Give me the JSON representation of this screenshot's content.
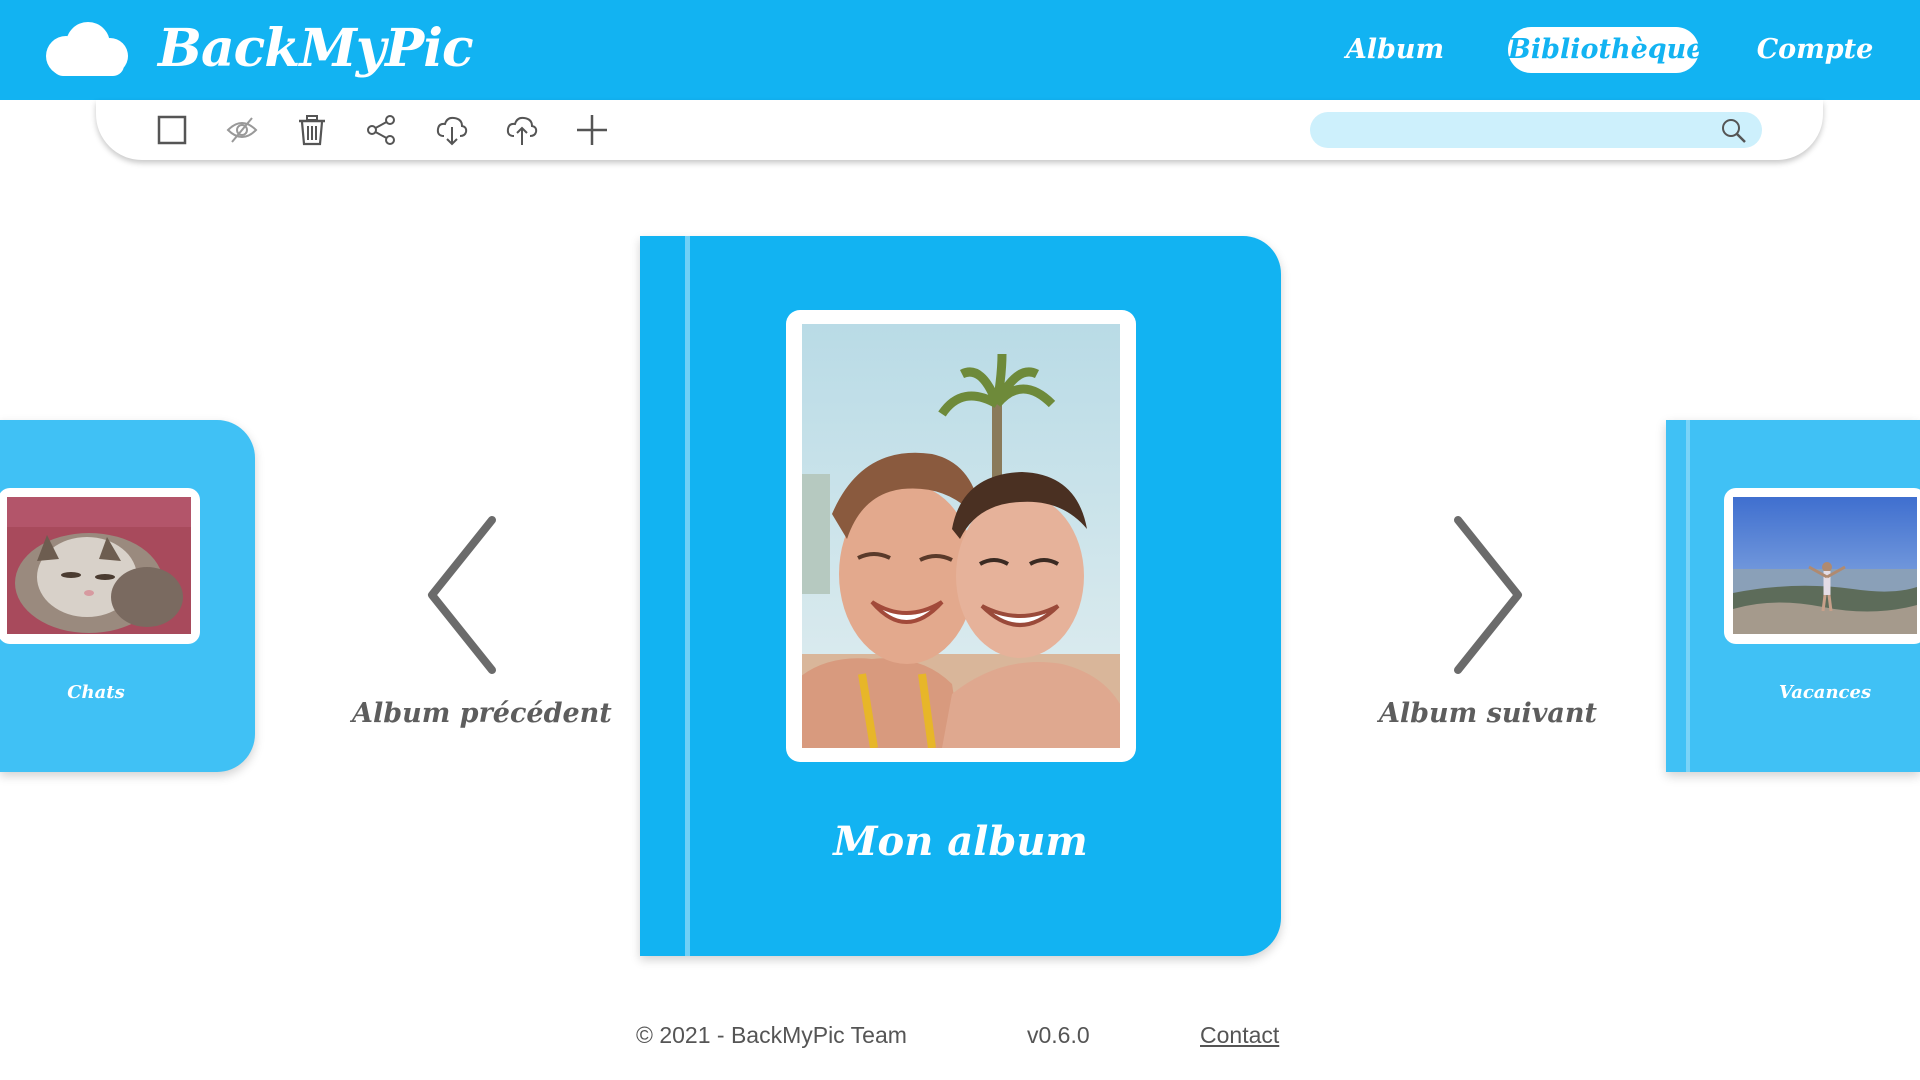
{
  "header": {
    "logo_text": "BackMyPic",
    "nav": {
      "album": "Album",
      "bibliotheque": "Bibliothèque",
      "compte": "Compte"
    },
    "active_nav": "Bibliothèque"
  },
  "toolbar": {
    "icons": [
      "checkbox-icon",
      "eye-off-icon",
      "trash-icon",
      "share-icon",
      "cloud-download-icon",
      "cloud-upload-icon",
      "plus-icon"
    ],
    "search": {
      "value": "",
      "placeholder": ""
    }
  },
  "albums": {
    "previous": {
      "title": "Chats"
    },
    "current": {
      "title": "Mon album"
    },
    "next": {
      "title": "Vacances"
    }
  },
  "navigation": {
    "previous_label": "Album précédent",
    "next_label": "Album suivant"
  },
  "footer": {
    "copyright": "© 2021 - BackMyPic Team",
    "version": "v0.6.0",
    "contact": "Contact"
  },
  "colors": {
    "primary": "#12b3f2",
    "secondary": "#40c1f5",
    "search_bg": "#cdf0fc",
    "icon_gray": "#5d5d5d"
  }
}
